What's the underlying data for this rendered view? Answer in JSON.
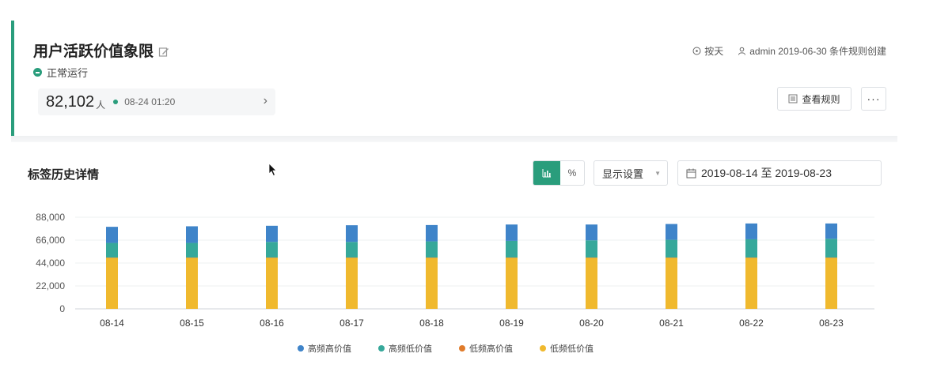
{
  "header": {
    "title": "用户活跃价值象限",
    "status": "正常运行",
    "count": "82,102",
    "count_unit": "人",
    "count_time": "08-24 01:20",
    "frequency": "按天",
    "creator_info": "admin 2019-06-30 条件规则创建",
    "view_rules_label": "查看规则",
    "more_label": "···"
  },
  "section": {
    "title": "标签历史详情",
    "percent_toggle": "%",
    "display_settings": "显示设置",
    "date_range": "2019-08-14 至 2019-08-23"
  },
  "colors": {
    "accent": "#2a9d7c",
    "high_high": "#3f84c9",
    "high_low": "#36a89a",
    "low_high": "#e07b2a",
    "low_low": "#f0b92e"
  },
  "chart_data": {
    "type": "bar",
    "stacked": true,
    "categories": [
      "08-14",
      "08-15",
      "08-16",
      "08-17",
      "08-18",
      "08-19",
      "08-20",
      "08-21",
      "08-22",
      "08-23"
    ],
    "series": [
      {
        "name": "低频低价值",
        "color": "#f0b92e",
        "values": [
          49000,
          49000,
          49000,
          49000,
          49000,
          49000,
          49000,
          49000,
          49000,
          49000
        ]
      },
      {
        "name": "低频高价值",
        "color": "#e07b2a",
        "values": [
          300,
          300,
          300,
          300,
          300,
          300,
          300,
          300,
          300,
          300
        ]
      },
      {
        "name": "高频低价值",
        "color": "#36a89a",
        "values": [
          14000,
          14000,
          15000,
          15000,
          15500,
          16000,
          16500,
          17000,
          17500,
          18000
        ]
      },
      {
        "name": "高频高价值",
        "color": "#3f84c9",
        "values": [
          15500,
          16000,
          15500,
          16000,
          15700,
          15700,
          15200,
          15200,
          15200,
          14700
        ]
      }
    ],
    "legend_order": [
      "高频高价值",
      "高频低价值",
      "低频高价值",
      "低频低价值"
    ],
    "y_ticks": [
      "0",
      "22,000",
      "44,000",
      "66,000",
      "88,000"
    ],
    "ylim": [
      0,
      88000
    ],
    "grid": true,
    "legend_position": "bottom"
  }
}
